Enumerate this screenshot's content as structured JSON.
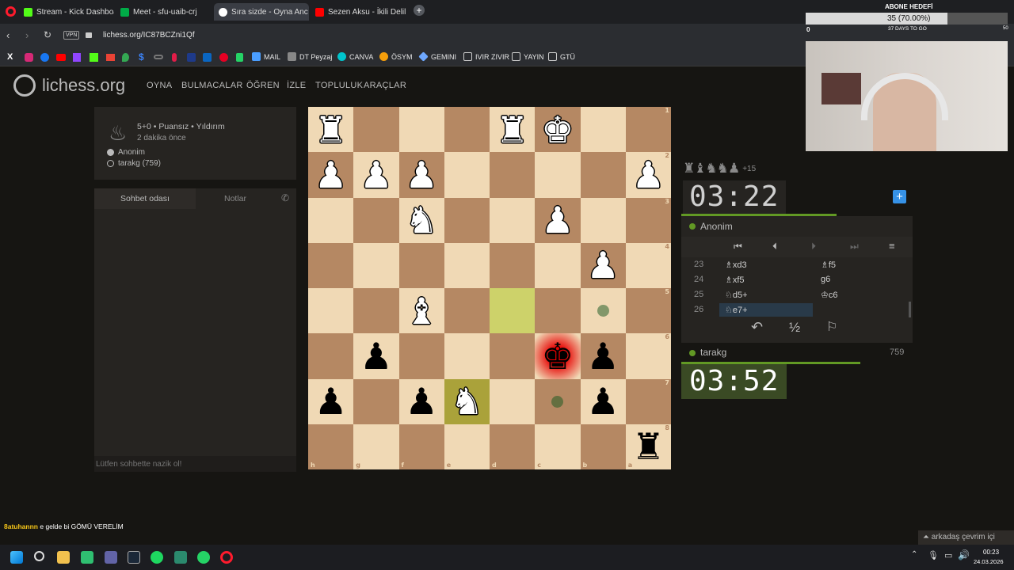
{
  "browser": {
    "tabs": [
      {
        "label": "Stream - Kick Dashboard",
        "icon": "kick-icon",
        "color": "#53fc18"
      },
      {
        "label": "Meet - sfu-uaib-crj",
        "icon": "meet-icon",
        "color": "#00ac47"
      },
      {
        "label": "Sıra sizde - Oyna Anc",
        "icon": "lichess-icon",
        "color": "#ffffff",
        "active": true
      },
      {
        "label": "Sezen Aksu - İkili Delil",
        "icon": "youtube-icon",
        "color": "#ff0000"
      }
    ],
    "vpn": "VPN",
    "url": "lichess.org/IC87BCZni1Qf",
    "bookmarks": [
      "MAIL",
      "DT Peyzaj",
      "CANVA",
      "ÖSYM",
      "GEMINI",
      "IVIR ZIVIR",
      "YAYIN",
      "GTÜ"
    ]
  },
  "site": {
    "logo": "lichess.org",
    "nav": [
      "OYNA",
      "BULMACALAR",
      "ÖĞREN",
      "İZLE",
      "TOPLULUK",
      "ARAÇLAR"
    ]
  },
  "game_info": {
    "mode": "5+0 • Puansız • Yıldırım",
    "time_ago": "2 dakika önce",
    "player_white": "Anonim",
    "player_black": "tarakg (759)"
  },
  "chat": {
    "tab_chat": "Sohbet odası",
    "tab_notes": "Notlar",
    "placeholder": "Lütfen sohbette nazik ol!"
  },
  "board": {
    "orientation": "black",
    "ranks": [
      "1",
      "2",
      "3",
      "4",
      "5",
      "6",
      "7",
      "8"
    ],
    "files": [
      "h",
      "g",
      "f",
      "e",
      "d",
      "c",
      "b",
      "a"
    ],
    "rows": [
      [
        "wR",
        "",
        "",
        "",
        "wR",
        "wK",
        "",
        ""
      ],
      [
        "wP",
        "wP",
        "wP",
        "",
        "",
        "",
        "",
        "wP"
      ],
      [
        "",
        "",
        "wN",
        "",
        "",
        "wP",
        "",
        ""
      ],
      [
        "",
        "",
        "",
        "",
        "",
        "",
        "wP",
        ""
      ],
      [
        "",
        "",
        "wB",
        "",
        "",
        "",
        "",
        ""
      ],
      [
        "",
        "bP",
        "",
        "",
        "",
        "bK",
        "bP",
        ""
      ],
      [
        "bP",
        "",
        "bP",
        "wN",
        "",
        "",
        "bP",
        ""
      ],
      [
        "",
        "",
        "",
        "",
        "",
        "",
        "",
        "bR"
      ]
    ],
    "last_move": [
      "4,4",
      "6,3"
    ],
    "check": "5,5",
    "move_dots": [
      "4,6",
      "6,5"
    ]
  },
  "opponent": {
    "captured": "♜♝♞♞♟",
    "material": "+15",
    "clock": "03:22",
    "name": "Anonim"
  },
  "moves": [
    {
      "n": "23",
      "w": "♗xd3",
      "b": "♗f5"
    },
    {
      "n": "24",
      "w": "♗xf5",
      "b": "g6"
    },
    {
      "n": "25",
      "w": "♘d5+",
      "b": "♔c6"
    },
    {
      "n": "26",
      "w": "♘e7+",
      "b": ""
    }
  ],
  "controls": {
    "draw": "½"
  },
  "me": {
    "name": "tarakg",
    "rating": "759",
    "clock": "03:52"
  },
  "stream": {
    "goal_title": "ABONE HEDEFİ",
    "goal_value": "35 (70.00%)",
    "goal_progress": 0.7,
    "goal_start": "0",
    "goal_end": "50",
    "goal_days": "37 DAYS TO GO",
    "chat_user": "8atuhannn",
    "chat_msg": "e gelde bi GÖMÜ VERELİM"
  },
  "friends": "arkadaş çevrim içi",
  "clock_tray": {
    "time": "00:23",
    "date": "24.03.2026"
  }
}
